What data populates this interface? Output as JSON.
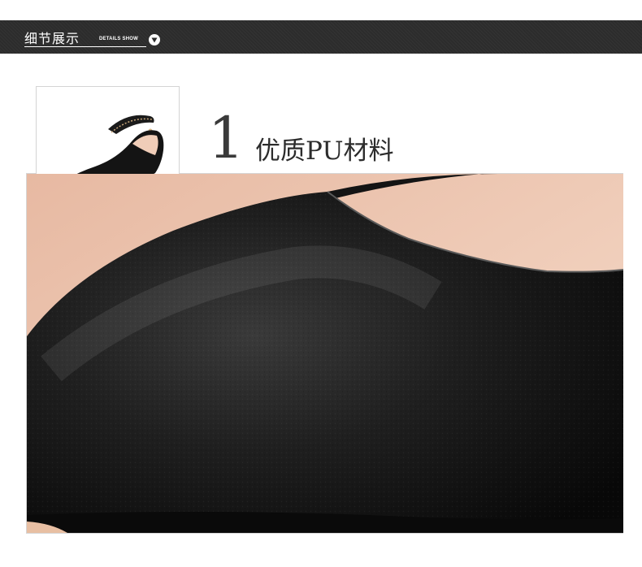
{
  "header": {
    "title": "细节展示",
    "subtitle": "DETAILS SHOW",
    "expand_icon": "chevron-down-icon"
  },
  "feature": {
    "number": "1.",
    "title": "优质PU材料"
  },
  "colors": {
    "header_bar": "#2c2c2c",
    "shoe_leather": "#141414",
    "shoe_lining": "#f0cdb8",
    "frame_line": "#d6d6d6"
  }
}
